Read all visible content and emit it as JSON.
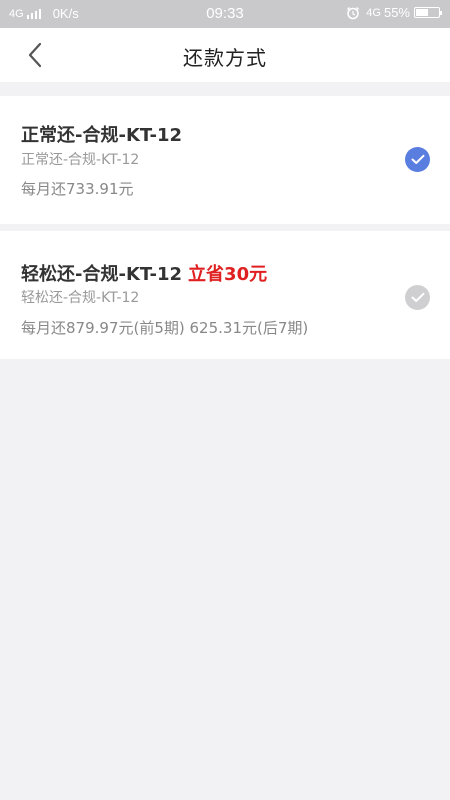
{
  "status_bar": {
    "network_left": "4G",
    "speed": "0K/s",
    "time": "09:33",
    "network_right": "4G",
    "battery_percent": "55%",
    "battery_level": 0.55
  },
  "header": {
    "title": "还款方式"
  },
  "plans": [
    {
      "name": "正常还-合规-KT-12",
      "badge": "",
      "subtitle": "正常还-合规-KT-12",
      "monthly": "每月还733.91元",
      "selected": true
    },
    {
      "name": "轻松还-合规-KT-12",
      "badge": "立省30元",
      "subtitle": "轻松还-合规-KT-12",
      "monthly": "每月还879.97元(前5期) 625.31元(后7期)",
      "selected": false
    }
  ],
  "colors": {
    "selected_check": "#5a7ee0",
    "unselected_check": "#cfcfd1",
    "badge": "#e02020",
    "status_bar": "#c9c9cb"
  }
}
